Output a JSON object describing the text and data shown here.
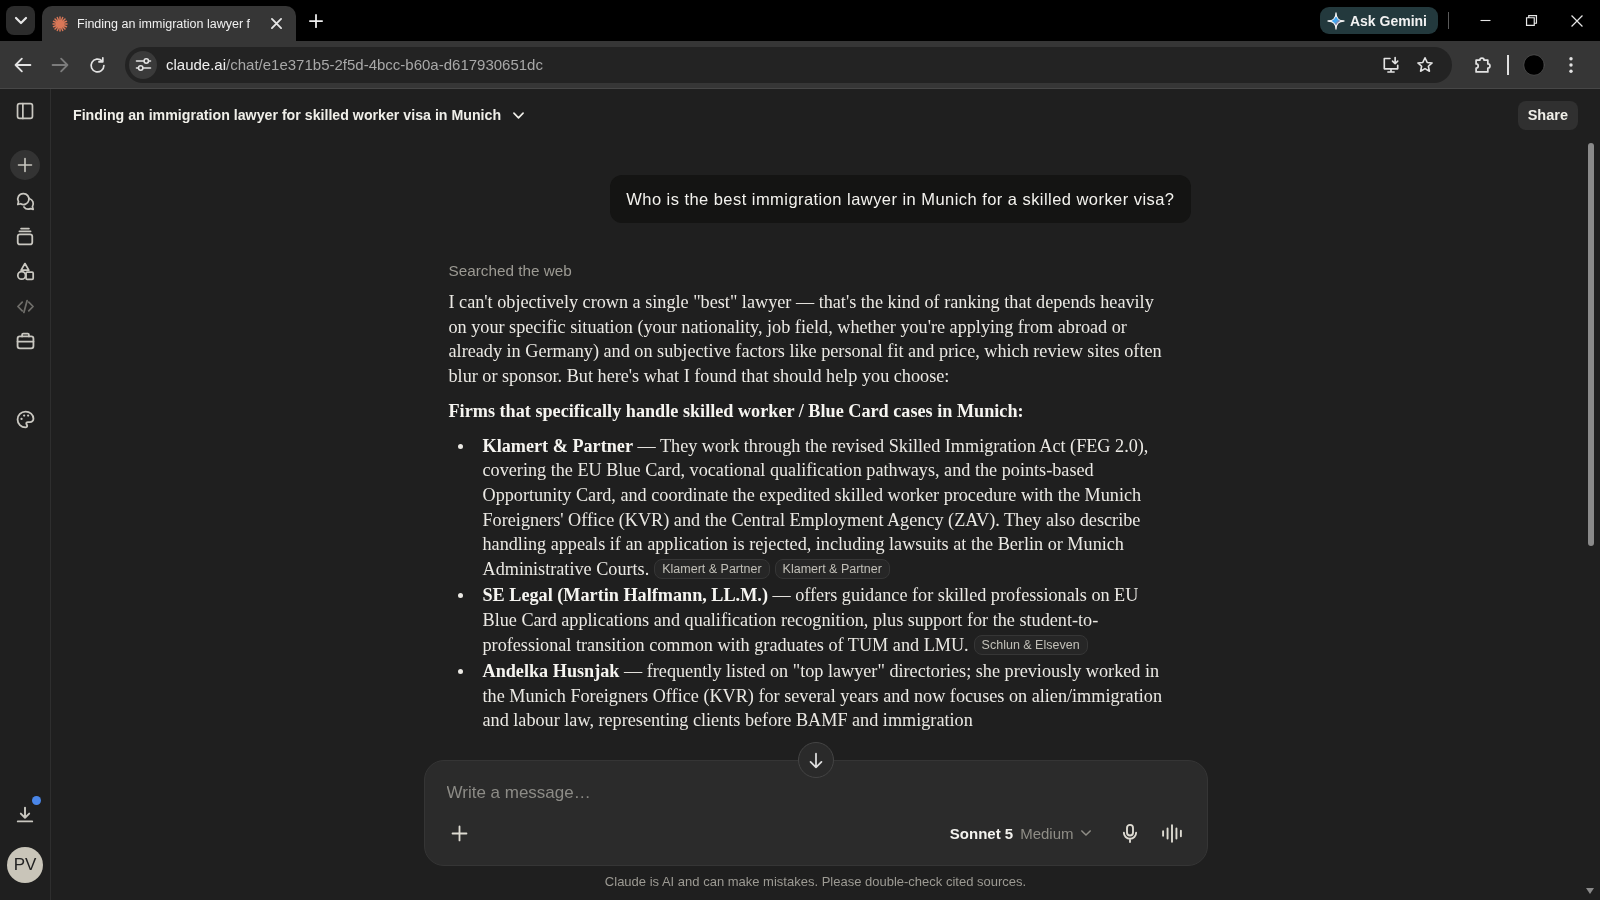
{
  "browser": {
    "tab": {
      "title": "Finding an immigration lawyer f",
      "selected": true
    },
    "ask_button": "Ask Gemini",
    "back": {
      "disabled": false
    },
    "forward": {
      "disabled": true
    },
    "address": {
      "host": "claude.ai",
      "path": "/chat/e1e371b5-2f5d-4bcc-b60a-d617930651dc"
    }
  },
  "sidebar": {
    "download_badge": true,
    "avatar": "PV"
  },
  "chat": {
    "title": "Finding an immigration lawyer for skilled worker visa in Munich",
    "share": "Share",
    "user_message": "Who is the best immigration lawyer in Munich for a skilled worker visa?",
    "response": [
      {
        "kind": "status",
        "text": "Searched the web"
      },
      {
        "kind": "paragraph",
        "text": "I can't objectively crown a single \"best\" lawyer — that's the kind of ranking that depends heavily on your specific situation (your nationality, job field, whether you're applying from abroad or already in Germany) and on subjective factors like personal fit and price, which review sites often blur or sponsor. But here's what I found that should help you choose:"
      },
      {
        "kind": "heading",
        "text": "Firms that specifically handle skilled worker / Blue Card cases in Munich:"
      },
      {
        "kind": "list",
        "items": [
          {
            "text": "**Klamert & Partner** — They work through the revised Skilled Immigration Act (FEG 2.0), covering the EU Blue Card, vocational qualification pathways, and the points-based Opportunity Card, and coordinate the expedited skilled worker procedure with the Munich Foreigners' Office (KVR) and the Central Employment Agency (ZAV). They also describe handling appeals if an application is rejected, including lawsuits at the Berlin or Munich Administrative Courts.",
            "citations": [
              "Klamert & Partner",
              "Klamert & Partner"
            ]
          },
          {
            "text": "**SE Legal (Martin Halfmann, LL.M.)** — offers guidance for skilled professionals on EU Blue Card applications and qualification recognition, plus support for the student-to-professional transition common with graduates of TUM and LMU.",
            "citations": [
              "Schlun & Elseven"
            ]
          },
          {
            "text": "**Andelka Husnjak** — frequently listed on \"top lawyer\" directories; she previously worked in the Munich Foreigners Office (KVR) for several years and now focuses on alien/immigration and labour law, representing clients before BAMF and immigration"
          }
        ]
      }
    ]
  },
  "composer": {
    "placeholder": "Write a message…",
    "model": "Sonnet 5",
    "effort": "Medium"
  },
  "disclaimer": "Claude is AI and can make mistakes. Please double-check cited sources."
}
